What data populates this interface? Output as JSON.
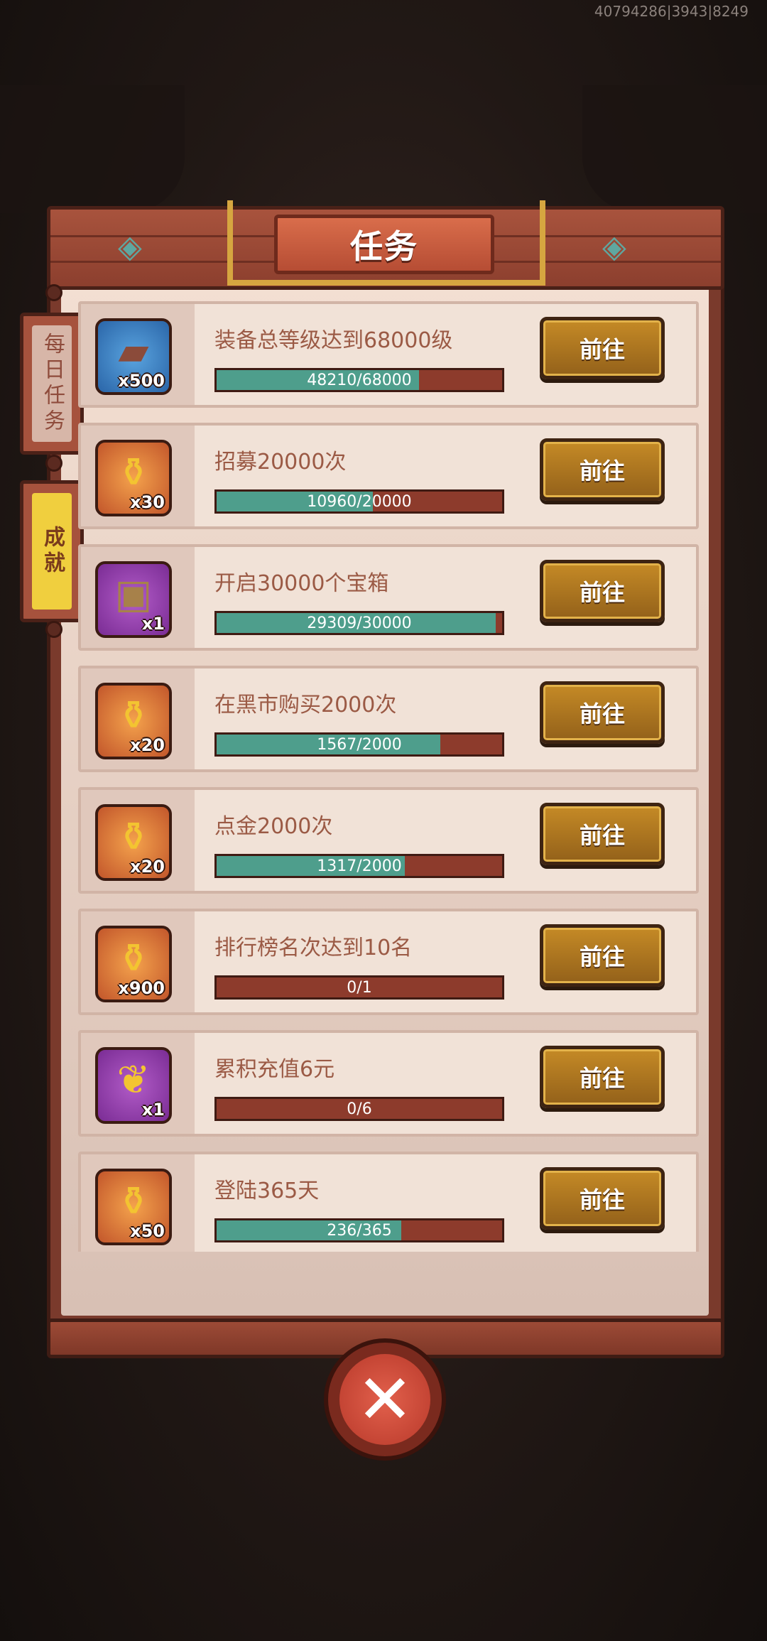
{
  "debug_info": "40794286|3943|8249",
  "title": "任务",
  "side_tabs": [
    {
      "label": "每日任务",
      "active": false
    },
    {
      "label": "成就",
      "active": true
    }
  ],
  "tasks": [
    {
      "title": "装备总等级达到68000级",
      "progress_text": "48210/68000",
      "progress": 0.709,
      "reward_icon": "equipment-icon",
      "reward_qty": "x500",
      "reward_frame": "blue",
      "button": "前往"
    },
    {
      "title": "招募20000次",
      "progress_text": "10960/20000",
      "progress": 0.548,
      "reward_icon": "gold-scroll-icon",
      "reward_qty": "x30",
      "reward_frame": "orange",
      "button": "前往"
    },
    {
      "title": "开启30000个宝箱",
      "progress_text": "29309/30000",
      "progress": 0.977,
      "reward_icon": "treasure-chest-icon",
      "reward_qty": "x1",
      "reward_frame": "purple",
      "button": "前往"
    },
    {
      "title": "在黑市购买2000次",
      "progress_text": "1567/2000",
      "progress": 0.784,
      "reward_icon": "gold-scroll-icon",
      "reward_qty": "x20",
      "reward_frame": "orange",
      "button": "前往"
    },
    {
      "title": "点金2000次",
      "progress_text": "1317/2000",
      "progress": 0.659,
      "reward_icon": "gold-scroll-icon",
      "reward_qty": "x20",
      "reward_frame": "orange",
      "button": "前往"
    },
    {
      "title": "排行榜名次达到10名",
      "progress_text": "0/1",
      "progress": 0,
      "reward_icon": "gold-scroll-icon",
      "reward_qty": "x900",
      "reward_frame": "orange",
      "button": "前往"
    },
    {
      "title": "累积充值6元",
      "progress_text": "0/6",
      "progress": 0,
      "reward_icon": "golden-torch-icon",
      "reward_qty": "x1",
      "reward_frame": "purple",
      "button": "前往"
    },
    {
      "title": "登陆365天",
      "progress_text": "236/365",
      "progress": 0.647,
      "reward_icon": "gold-scroll-icon",
      "reward_qty": "x50",
      "reward_frame": "orange",
      "button": "前往"
    }
  ],
  "close_glyph": "✕"
}
